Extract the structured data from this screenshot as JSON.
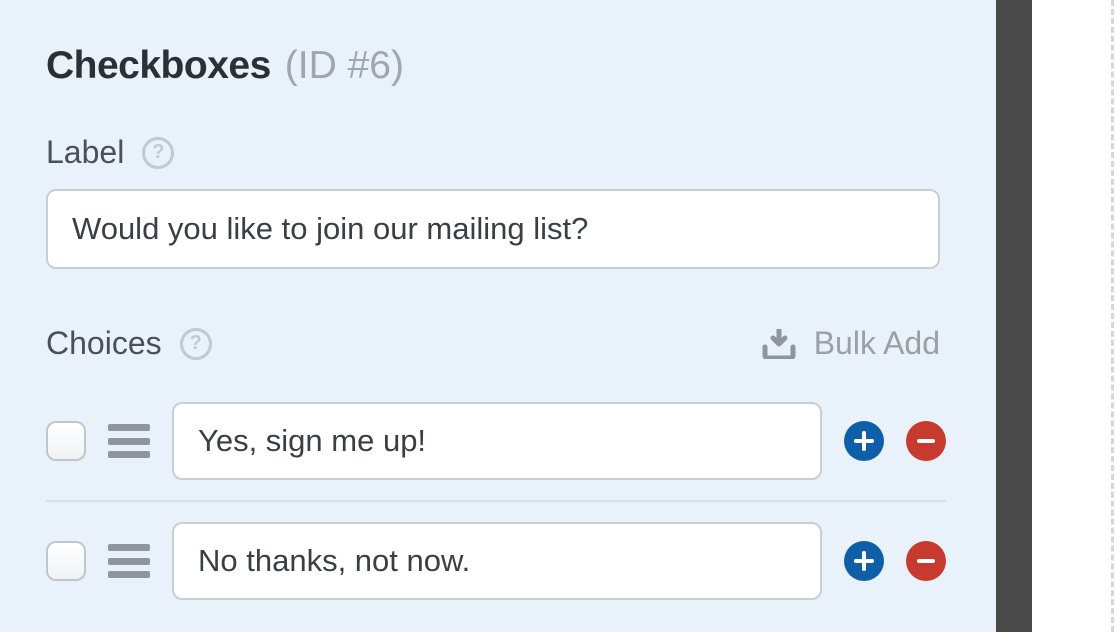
{
  "field": {
    "type_label": "Checkboxes",
    "id_label": "(ID #6)"
  },
  "label_section": {
    "label": "Label",
    "value": "Would you like to join our mailing list?"
  },
  "choices_section": {
    "label": "Choices",
    "bulk_add_label": "Bulk Add",
    "items": [
      {
        "value": "Yes, sign me up!",
        "checked": false
      },
      {
        "value": "No thanks, not now.",
        "checked": false
      }
    ]
  },
  "icons": {
    "help": "help-icon",
    "download": "download-icon",
    "drag": "drag-handle-icon",
    "add": "plus-circle-icon",
    "remove": "minus-circle-icon"
  },
  "colors": {
    "panel_bg": "#e9f1fa",
    "text_primary": "#2c2f36",
    "text_muted": "#a0a6ad",
    "add_btn": "#0f5ea8",
    "remove_btn": "#c73a2f"
  }
}
